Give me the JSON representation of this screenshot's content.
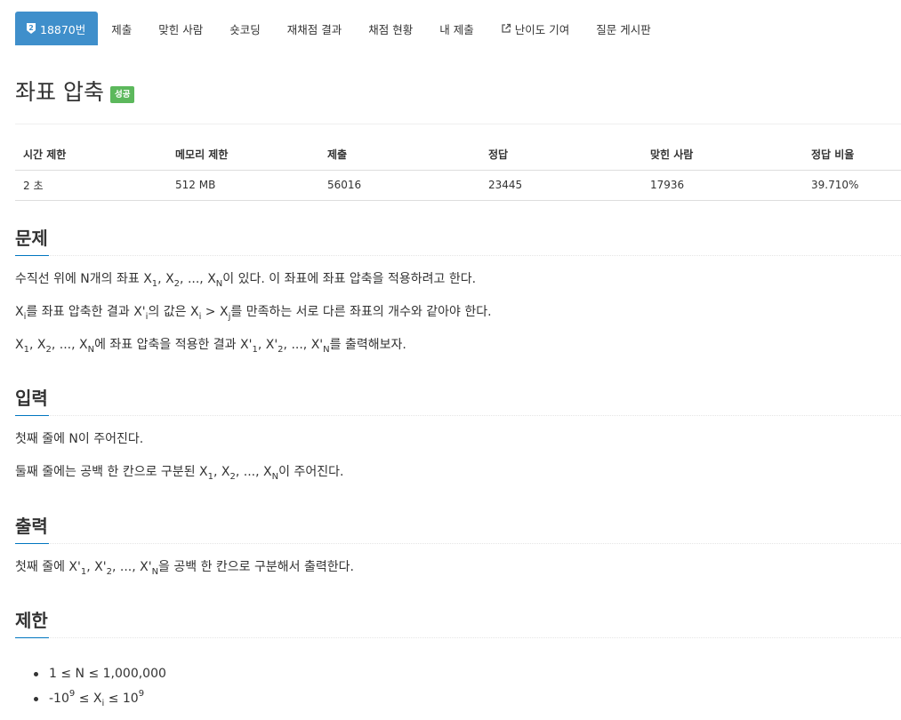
{
  "nav": {
    "problem_id": "18870번",
    "tabs": [
      {
        "label": "제출"
      },
      {
        "label": "맞힌 사람"
      },
      {
        "label": "숏코딩"
      },
      {
        "label": "재채점 결과"
      },
      {
        "label": "채점 현황"
      },
      {
        "label": "내 제출"
      },
      {
        "label": "난이도 기여",
        "icon": "external-link-icon"
      },
      {
        "label": "질문 게시판"
      }
    ],
    "tier_icon": "silver-tier-badge-icon",
    "tier_level": "2",
    "active_color": "#3f8fcb"
  },
  "title": {
    "text": "좌표 압축",
    "status": "성공",
    "status_color": "#5cb85c"
  },
  "info_table": {
    "headers": [
      "시간 제한",
      "메모리 제한",
      "제출",
      "정답",
      "맞힌 사람",
      "정답 비율"
    ],
    "values": [
      "2 초",
      "512 MB",
      "56016",
      "23445",
      "17936",
      "39.710%"
    ]
  },
  "sections": {
    "problem": {
      "title": "문제",
      "p1": {
        "pre": "수직선 위에 N개의 좌표 X",
        "s1": "1",
        "t1": ", X",
        "s2": "2",
        "t2": ", ..., X",
        "s3": "N",
        "post": "이 있다. 이 좌표에 좌표 압축을 적용하려고 한다."
      },
      "p2": {
        "a": "X",
        "sa": "i",
        "b": "를 좌표 압축한 결과 X'",
        "sb": "i",
        "c": "의 값은 X",
        "sc": "i",
        "d": " > X",
        "sd": "j",
        "e": "를 만족하는 서로 다른 좌표의 개수와 같아야 한다."
      },
      "p3": {
        "a": "X",
        "s1": "1",
        "b": ", X",
        "s2": "2",
        "c": ", ..., X",
        "s3": "N",
        "d": "에 좌표 압축을 적용한 결과 X'",
        "s4": "1",
        "e": ", X'",
        "s5": "2",
        "f": ", ..., X'",
        "s6": "N",
        "g": "를 출력해보자."
      }
    },
    "input": {
      "title": "입력",
      "p1": "첫째 줄에 N이 주어진다.",
      "p2": {
        "a": "둘째 줄에는 공백 한 칸으로 구분된 X",
        "s1": "1",
        "b": ", X",
        "s2": "2",
        "c": ", ..., X",
        "s3": "N",
        "d": "이 주어진다."
      }
    },
    "output": {
      "title": "출력",
      "p1": {
        "a": "첫째 줄에 X'",
        "s1": "1",
        "b": ", X'",
        "s2": "2",
        "c": ", ..., X'",
        "s3": "N",
        "d": "을 공백 한 칸으로 구분해서 출력한다."
      }
    },
    "limits": {
      "title": "제한",
      "l1": "1 ≤ N ≤ 1,000,000",
      "l2": {
        "a": "-10",
        "sup1": "9",
        "b": " ≤ X",
        "sub": "i",
        "c": " ≤ 10",
        "sup2": "9"
      }
    }
  }
}
